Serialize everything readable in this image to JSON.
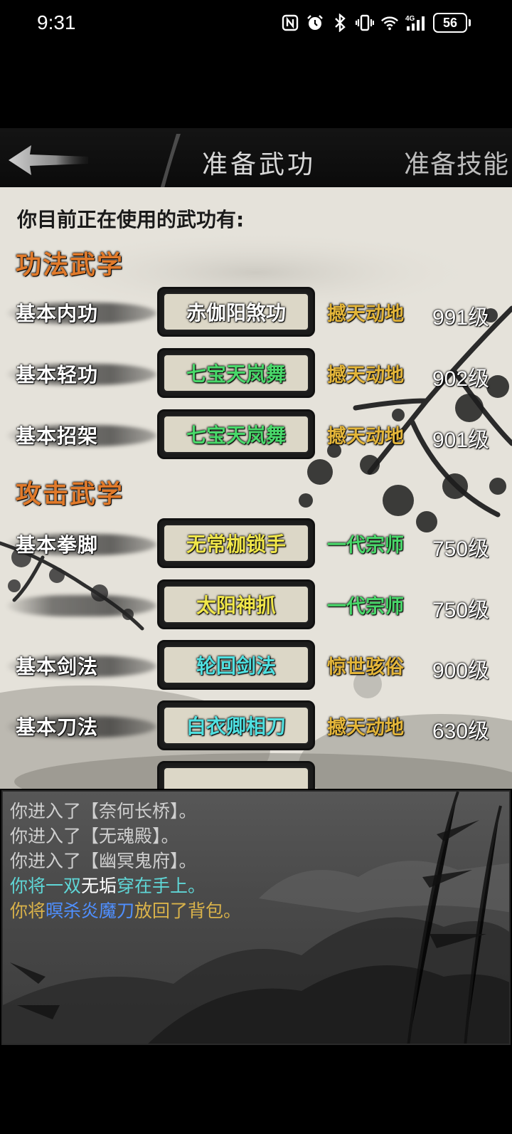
{
  "status": {
    "time": "9:31",
    "battery": "56",
    "network": "4G",
    "icons": [
      "nfc-icon",
      "alarm-icon",
      "bluetooth-icon",
      "vibrate-icon",
      "wifi-icon",
      "signal-icon",
      "battery-icon"
    ]
  },
  "nav": {
    "title": "准备武功",
    "skills_tab": "准备技能",
    "back_icon": "arrow-left-icon"
  },
  "intro": "你目前正在使用的武功有:",
  "sections": [
    {
      "title": "功法武学"
    },
    {
      "title": "攻击武学"
    }
  ],
  "rows": [
    {
      "label": "基本内功",
      "skill": "赤伽阳煞功",
      "skill_color": "#ffffff",
      "rank": "撼天动地",
      "rank_color": "#e3b53a",
      "level": "991级"
    },
    {
      "label": "基本轻功",
      "skill": "七宝天岚舞",
      "skill_color": "#49d86a",
      "rank": "撼天动地",
      "rank_color": "#e3b53a",
      "level": "902级"
    },
    {
      "label": "基本招架",
      "skill": "七宝天岚舞",
      "skill_color": "#49d86a",
      "rank": "撼天动地",
      "rank_color": "#e3b53a",
      "level": "901级"
    },
    {
      "label": "基本拳脚",
      "skill": "无常枷锁手",
      "skill_color": "#f0e64a",
      "rank": "一代宗师",
      "rank_color": "#49d86a",
      "level": "750级"
    },
    {
      "label": "",
      "skill": "太阳神抓",
      "skill_color": "#f0e64a",
      "rank": "一代宗师",
      "rank_color": "#49d86a",
      "level": "750级"
    },
    {
      "label": "基本剑法",
      "skill": "轮回剑法",
      "skill_color": "#4fe0e0",
      "rank": "惊世骇俗",
      "rank_color": "#e3b53a",
      "level": "900级"
    },
    {
      "label": "基本刀法",
      "skill": "白衣卿相刀",
      "skill_color": "#4fe0e0",
      "rank": "撼天动地",
      "rank_color": "#e3b53a",
      "level": "630级"
    }
  ],
  "log": [
    {
      "parts": [
        {
          "text": "你进入了【奈何长桥】。",
          "color": "#cfcfcf"
        }
      ]
    },
    {
      "parts": [
        {
          "text": "你进入了【无魂殿】。",
          "color": "#cfcfcf"
        }
      ]
    },
    {
      "parts": [
        {
          "text": "你进入了【幽冥鬼府】。",
          "color": "#cfcfcf"
        }
      ]
    },
    {
      "parts": [
        {
          "text": "你将一双",
          "color": "#5fd6d6"
        },
        {
          "text": "无垢",
          "color": "#ffffff"
        },
        {
          "text": "穿在手上。",
          "color": "#5fd6d6"
        }
      ]
    },
    {
      "parts": [
        {
          "text": "你将",
          "color": "#d9b24a"
        },
        {
          "text": "暝杀炎魔刀",
          "color": "#4f8fff"
        },
        {
          "text": "放回了背包。",
          "color": "#d9b24a"
        }
      ]
    }
  ]
}
